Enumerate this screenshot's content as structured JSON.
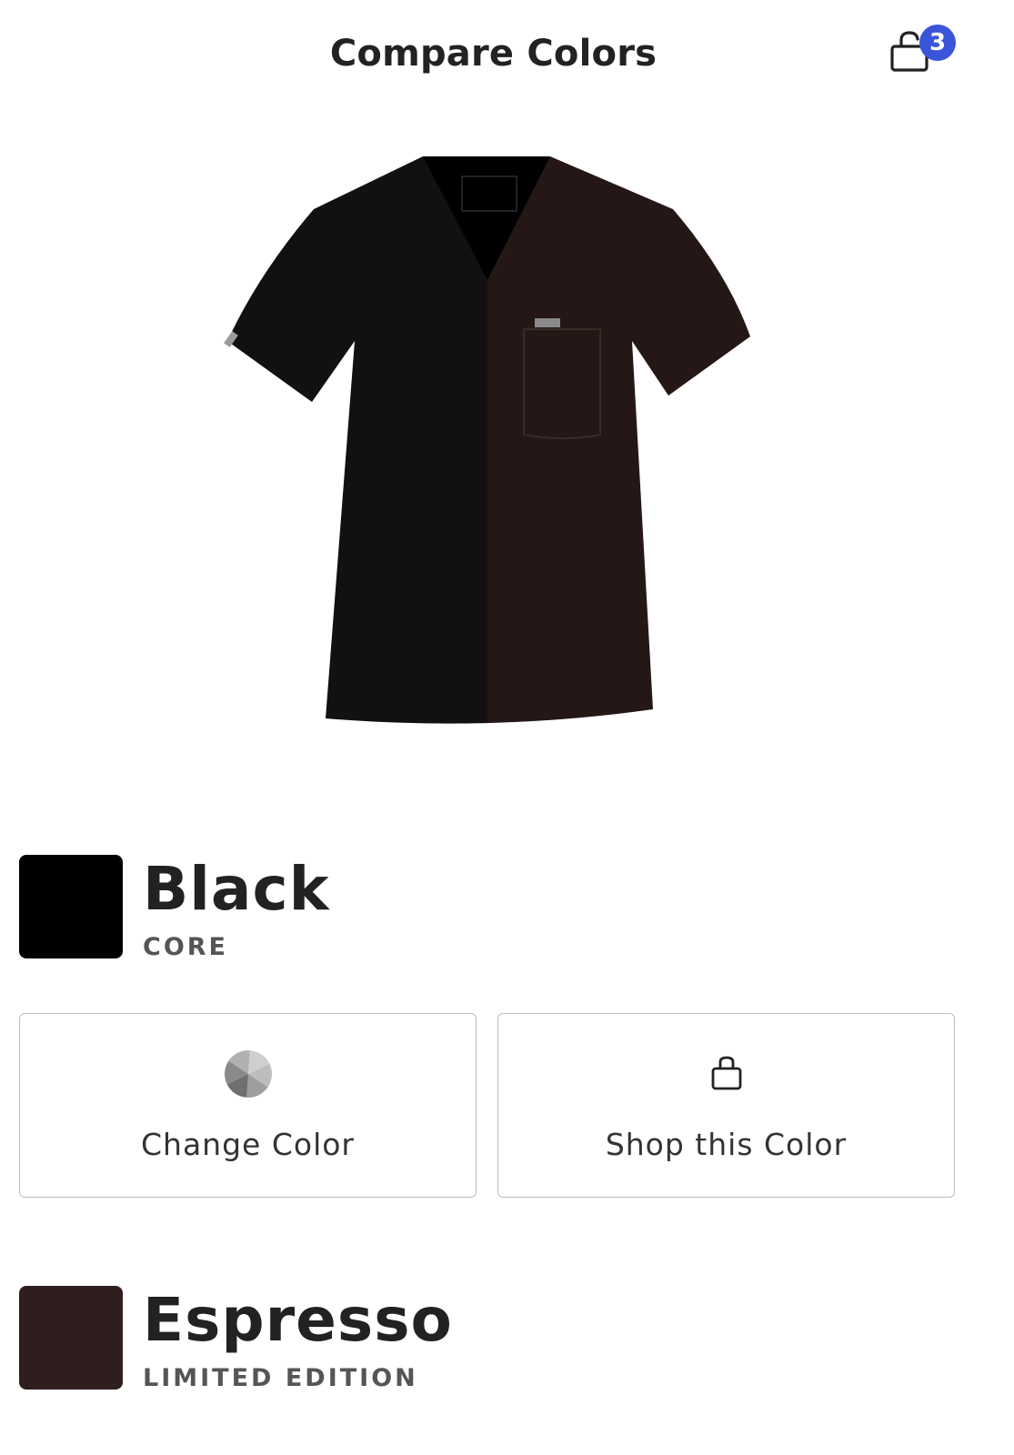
{
  "header": {
    "title": "Compare Colors",
    "cart_count": "3",
    "badge_color": "#3b55d9"
  },
  "product": {
    "left_color": "#111111",
    "right_color": "#241716"
  },
  "colors": [
    {
      "name": "Black",
      "category": "CORE",
      "swatch": "#000000"
    },
    {
      "name": "Espresso",
      "category": "LIMITED EDITION",
      "swatch": "#2e1e1e"
    }
  ],
  "actions": {
    "change_color": {
      "label": "Change Color",
      "icon": "color-wheel-icon"
    },
    "shop_color": {
      "label": "Shop this Color",
      "icon": "shopping-bag-icon"
    }
  }
}
